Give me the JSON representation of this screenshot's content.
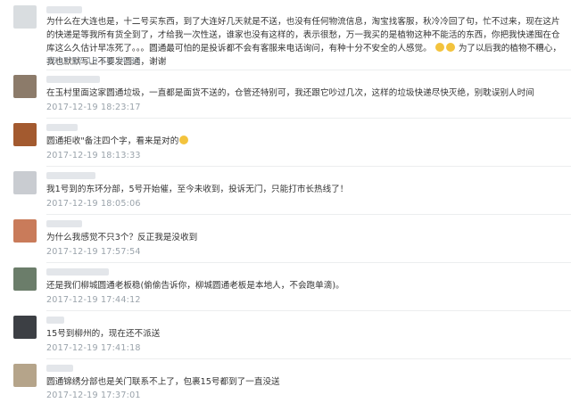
{
  "comments": [
    {
      "text": "为什么在大连也是，十二号买东西，到了大连好几天就是不送，也没有任何物流信息，淘宝找客服，秋冷冷回了句，忙不过来，现在这片的快递是等我所有货全到了，才给我一次性送，谁家也没有这样的，表示很愁，万一我买的是植物这种不能活的东西，你把我快递囤在仓库这么久估计早冻死了。。。圆通最可怕的是投诉都不会有客服来电话询问，有种十分不安全的人感觉。",
      "tail": "为了以后我的植物不糟心，我也默默写上不要发圆通，谢谢",
      "time": "2017-12-19 18:24:38",
      "avatar_color": "#d9dde0"
    },
    {
      "text": "在玉村里面这家圆通垃圾，一直都是面货不送的，仓管还特别可，我还跟它吵过几次，这样的垃圾快递尽快灭绝，别耽误别人时间",
      "time": "2017-12-19 18:23:17",
      "avatar_color": "#8c7b6a"
    },
    {
      "text": "圆通拒收\"备注四个字，看来是对的",
      "time": "2017-12-19 18:13:33",
      "avatar_color": "#a35a2f"
    },
    {
      "text": "我1号到的东环分部，5号开始催，至今未收到，投诉无门，只能打市长热线了！",
      "time": "2017-12-19 18:05:06",
      "avatar_color": "#c9ccd1"
    },
    {
      "text": "为什么我感觉不只3个？反正我是没收到",
      "time": "2017-12-19 17:57:54",
      "avatar_color": "#c97b5a"
    },
    {
      "text": "还是我们柳城圆通老板稳(偷偷告诉你，柳城圆通老板是本地人，不会跑单滴)。",
      "time": "2017-12-19 17:44:12",
      "avatar_color": "#6b7d6a"
    },
    {
      "text": "15号到柳州的，现在还不派送",
      "time": "2017-12-19 17:41:18",
      "avatar_color": "#3c3f44"
    },
    {
      "text": "圆通锦绣分部也是关门联系不上了，包裹15号都到了一直没送",
      "time": "2017-12-19 17:37:01",
      "avatar_color": "#b5a48a"
    }
  ],
  "icons": {
    "emoji": "smiley-emoji-icon",
    "emoji_color": "#f3c33d"
  }
}
